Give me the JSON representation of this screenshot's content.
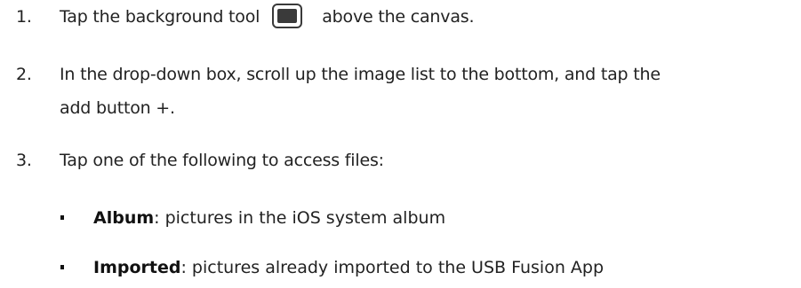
{
  "steps": [
    {
      "number": "1.",
      "text_before": "Tap the background tool",
      "icon": "background-tool-icon",
      "text_after": "above the canvas."
    },
    {
      "number": "2.",
      "line1": "In the drop-down box, scroll up the image list to the bottom, and tap the",
      "line2": "add button +."
    },
    {
      "number": "3.",
      "text": "Tap one of the following to access files:"
    }
  ],
  "options": [
    {
      "term": "Album",
      "description": ": pictures in the iOS system album"
    },
    {
      "term": "Imported",
      "description": ": pictures already imported to the USB Fusion App"
    }
  ],
  "colors": {
    "text": "#222222",
    "icon": "#3a3a3a"
  }
}
